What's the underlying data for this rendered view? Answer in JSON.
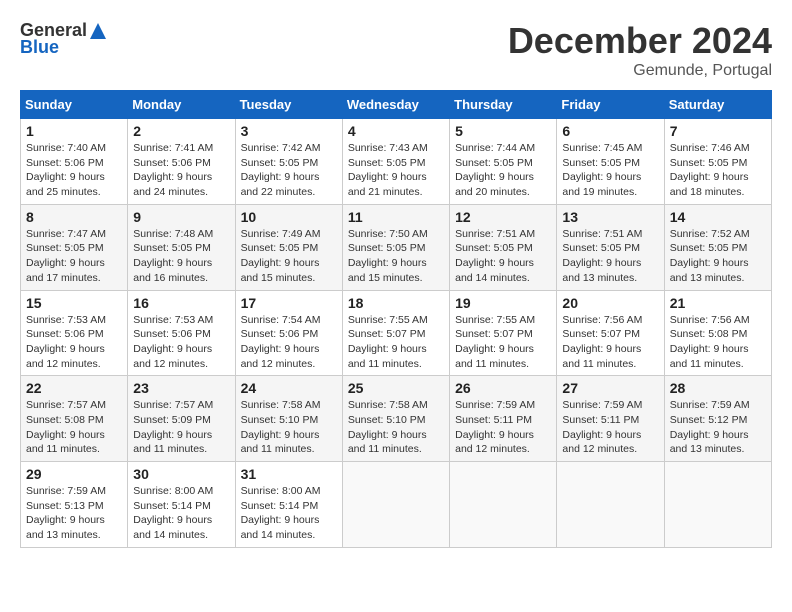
{
  "header": {
    "logo_general": "General",
    "logo_blue": "Blue",
    "month_year": "December 2024",
    "location": "Gemunde, Portugal"
  },
  "weekdays": [
    "Sunday",
    "Monday",
    "Tuesday",
    "Wednesday",
    "Thursday",
    "Friday",
    "Saturday"
  ],
  "weeks": [
    [
      {
        "day": "1",
        "sunrise": "Sunrise: 7:40 AM",
        "sunset": "Sunset: 5:06 PM",
        "daylight": "Daylight: 9 hours and 25 minutes."
      },
      {
        "day": "2",
        "sunrise": "Sunrise: 7:41 AM",
        "sunset": "Sunset: 5:06 PM",
        "daylight": "Daylight: 9 hours and 24 minutes."
      },
      {
        "day": "3",
        "sunrise": "Sunrise: 7:42 AM",
        "sunset": "Sunset: 5:05 PM",
        "daylight": "Daylight: 9 hours and 22 minutes."
      },
      {
        "day": "4",
        "sunrise": "Sunrise: 7:43 AM",
        "sunset": "Sunset: 5:05 PM",
        "daylight": "Daylight: 9 hours and 21 minutes."
      },
      {
        "day": "5",
        "sunrise": "Sunrise: 7:44 AM",
        "sunset": "Sunset: 5:05 PM",
        "daylight": "Daylight: 9 hours and 20 minutes."
      },
      {
        "day": "6",
        "sunrise": "Sunrise: 7:45 AM",
        "sunset": "Sunset: 5:05 PM",
        "daylight": "Daylight: 9 hours and 19 minutes."
      },
      {
        "day": "7",
        "sunrise": "Sunrise: 7:46 AM",
        "sunset": "Sunset: 5:05 PM",
        "daylight": "Daylight: 9 hours and 18 minutes."
      }
    ],
    [
      {
        "day": "8",
        "sunrise": "Sunrise: 7:47 AM",
        "sunset": "Sunset: 5:05 PM",
        "daylight": "Daylight: 9 hours and 17 minutes."
      },
      {
        "day": "9",
        "sunrise": "Sunrise: 7:48 AM",
        "sunset": "Sunset: 5:05 PM",
        "daylight": "Daylight: 9 hours and 16 minutes."
      },
      {
        "day": "10",
        "sunrise": "Sunrise: 7:49 AM",
        "sunset": "Sunset: 5:05 PM",
        "daylight": "Daylight: 9 hours and 15 minutes."
      },
      {
        "day": "11",
        "sunrise": "Sunrise: 7:50 AM",
        "sunset": "Sunset: 5:05 PM",
        "daylight": "Daylight: 9 hours and 15 minutes."
      },
      {
        "day": "12",
        "sunrise": "Sunrise: 7:51 AM",
        "sunset": "Sunset: 5:05 PM",
        "daylight": "Daylight: 9 hours and 14 minutes."
      },
      {
        "day": "13",
        "sunrise": "Sunrise: 7:51 AM",
        "sunset": "Sunset: 5:05 PM",
        "daylight": "Daylight: 9 hours and 13 minutes."
      },
      {
        "day": "14",
        "sunrise": "Sunrise: 7:52 AM",
        "sunset": "Sunset: 5:05 PM",
        "daylight": "Daylight: 9 hours and 13 minutes."
      }
    ],
    [
      {
        "day": "15",
        "sunrise": "Sunrise: 7:53 AM",
        "sunset": "Sunset: 5:06 PM",
        "daylight": "Daylight: 9 hours and 12 minutes."
      },
      {
        "day": "16",
        "sunrise": "Sunrise: 7:53 AM",
        "sunset": "Sunset: 5:06 PM",
        "daylight": "Daylight: 9 hours and 12 minutes."
      },
      {
        "day": "17",
        "sunrise": "Sunrise: 7:54 AM",
        "sunset": "Sunset: 5:06 PM",
        "daylight": "Daylight: 9 hours and 12 minutes."
      },
      {
        "day": "18",
        "sunrise": "Sunrise: 7:55 AM",
        "sunset": "Sunset: 5:07 PM",
        "daylight": "Daylight: 9 hours and 11 minutes."
      },
      {
        "day": "19",
        "sunrise": "Sunrise: 7:55 AM",
        "sunset": "Sunset: 5:07 PM",
        "daylight": "Daylight: 9 hours and 11 minutes."
      },
      {
        "day": "20",
        "sunrise": "Sunrise: 7:56 AM",
        "sunset": "Sunset: 5:07 PM",
        "daylight": "Daylight: 9 hours and 11 minutes."
      },
      {
        "day": "21",
        "sunrise": "Sunrise: 7:56 AM",
        "sunset": "Sunset: 5:08 PM",
        "daylight": "Daylight: 9 hours and 11 minutes."
      }
    ],
    [
      {
        "day": "22",
        "sunrise": "Sunrise: 7:57 AM",
        "sunset": "Sunset: 5:08 PM",
        "daylight": "Daylight: 9 hours and 11 minutes."
      },
      {
        "day": "23",
        "sunrise": "Sunrise: 7:57 AM",
        "sunset": "Sunset: 5:09 PM",
        "daylight": "Daylight: 9 hours and 11 minutes."
      },
      {
        "day": "24",
        "sunrise": "Sunrise: 7:58 AM",
        "sunset": "Sunset: 5:10 PM",
        "daylight": "Daylight: 9 hours and 11 minutes."
      },
      {
        "day": "25",
        "sunrise": "Sunrise: 7:58 AM",
        "sunset": "Sunset: 5:10 PM",
        "daylight": "Daylight: 9 hours and 11 minutes."
      },
      {
        "day": "26",
        "sunrise": "Sunrise: 7:59 AM",
        "sunset": "Sunset: 5:11 PM",
        "daylight": "Daylight: 9 hours and 12 minutes."
      },
      {
        "day": "27",
        "sunrise": "Sunrise: 7:59 AM",
        "sunset": "Sunset: 5:11 PM",
        "daylight": "Daylight: 9 hours and 12 minutes."
      },
      {
        "day": "28",
        "sunrise": "Sunrise: 7:59 AM",
        "sunset": "Sunset: 5:12 PM",
        "daylight": "Daylight: 9 hours and 13 minutes."
      }
    ],
    [
      {
        "day": "29",
        "sunrise": "Sunrise: 7:59 AM",
        "sunset": "Sunset: 5:13 PM",
        "daylight": "Daylight: 9 hours and 13 minutes."
      },
      {
        "day": "30",
        "sunrise": "Sunrise: 8:00 AM",
        "sunset": "Sunset: 5:14 PM",
        "daylight": "Daylight: 9 hours and 14 minutes."
      },
      {
        "day": "31",
        "sunrise": "Sunrise: 8:00 AM",
        "sunset": "Sunset: 5:14 PM",
        "daylight": "Daylight: 9 hours and 14 minutes."
      },
      {
        "day": "",
        "sunrise": "",
        "sunset": "",
        "daylight": ""
      },
      {
        "day": "",
        "sunrise": "",
        "sunset": "",
        "daylight": ""
      },
      {
        "day": "",
        "sunrise": "",
        "sunset": "",
        "daylight": ""
      },
      {
        "day": "",
        "sunrise": "",
        "sunset": "",
        "daylight": ""
      }
    ]
  ]
}
